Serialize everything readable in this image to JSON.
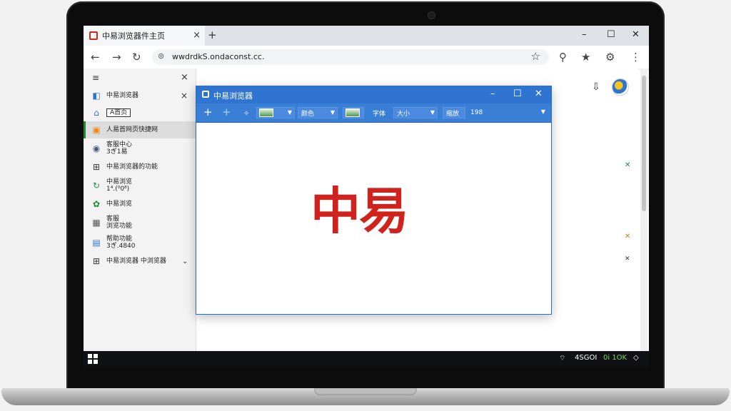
{
  "tab": {
    "title": "中易浏览器件主页",
    "close": "×",
    "new": "+"
  },
  "window_controls": {
    "minimize": "–",
    "maximize": "☐",
    "close": "✕"
  },
  "toolbar": {
    "back": "←",
    "forward": "→",
    "reload": "↻",
    "url": "wwdrdkS.ondaconst.cc.",
    "bookmark": "☆",
    "search": "⚲",
    "extensions": "★",
    "settings": "⚙",
    "menu": "⋮"
  },
  "sidebar": {
    "menu": "≡",
    "close": "×",
    "items": [
      {
        "label": "中易浏览器",
        "extra": "×"
      },
      {
        "label": "A首页"
      },
      {
        "label": "人易首网页快捷网"
      },
      {
        "label": "客服中心",
        "label2": "3ぎ1易"
      },
      {
        "label": "中易浏览器的功能"
      },
      {
        "label": "中易浏览",
        "label2": "1⁴.(⁰0⁸)"
      },
      {
        "label": "中易浏览"
      },
      {
        "label": "客服",
        "label2": "浏览功能"
      },
      {
        "label": "帮助功能",
        "label2": "3ぎ.4840"
      },
      {
        "label": "中易浏览器 中浏览器",
        "extra": "⌄"
      }
    ]
  },
  "content": {
    "profile_icon": "⇩"
  },
  "dialog": {
    "title": "中易浏览器",
    "add": "+",
    "add2": "+",
    "combo1": "",
    "combo2": "颜色",
    "combo3": "字体",
    "combo4": "大小",
    "combo5": "缩放",
    "zoom": "198",
    "main_text": "中易"
  },
  "taskbar": {
    "clock": "4SGOI",
    "status": "0i 1OK"
  }
}
